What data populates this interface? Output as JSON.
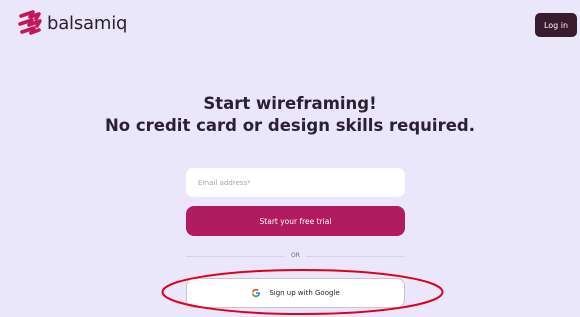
{
  "header": {
    "logo_text": "balsamiq",
    "login_label": "Log in"
  },
  "hero": {
    "line1": "Start wireframing!",
    "line2": "No credit card or design skills required."
  },
  "form": {
    "email_placeholder": "Email address*",
    "trial_label": "Start your free trial",
    "or_label": "OR",
    "google_label": "Sign up with Google"
  },
  "icons": {
    "logo": "balsamiq-logo-icon",
    "google": "google-g-icon"
  },
  "colors": {
    "background": "#ebe7fb",
    "logo_pink": "#c2185b",
    "login_bg": "#3a1a2d",
    "trial_bg": "#b01c5f",
    "annotation": "#e0001a"
  }
}
